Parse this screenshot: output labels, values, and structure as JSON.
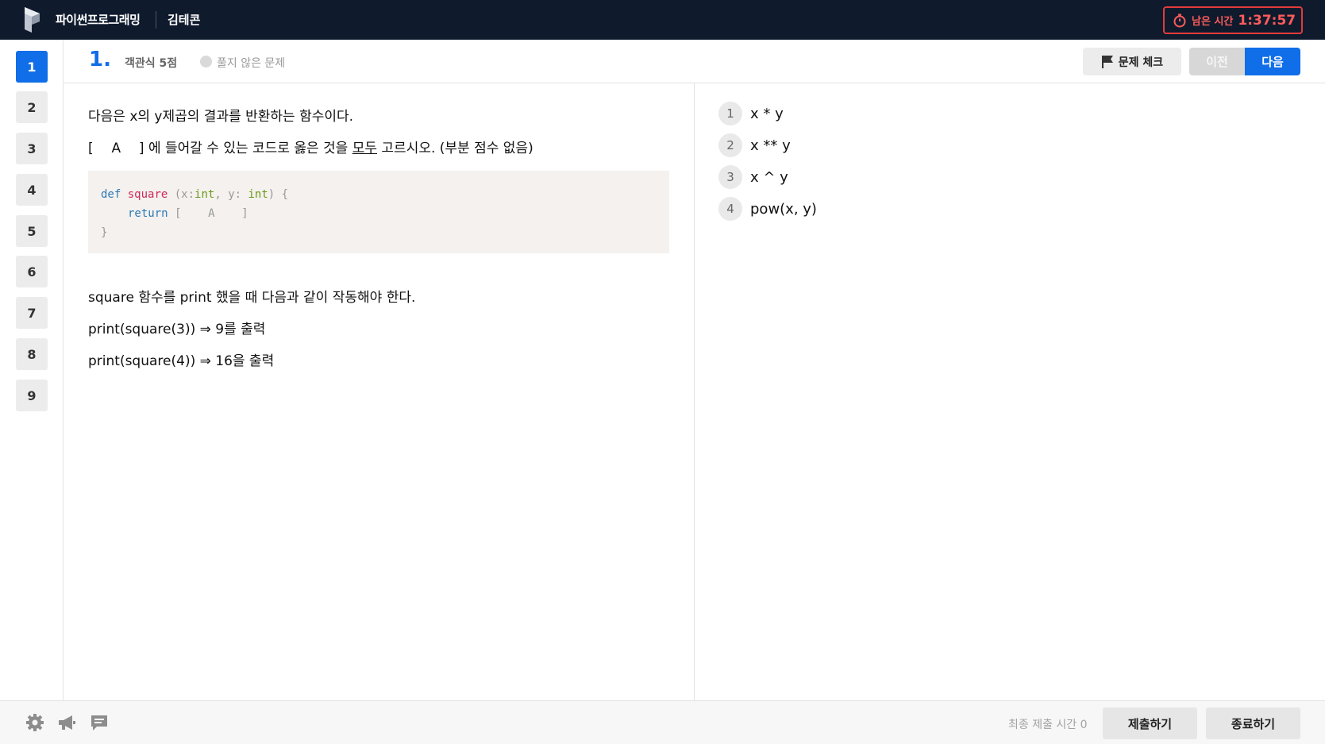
{
  "header": {
    "brand": "파이썬프로그래밍",
    "user": "김테콘",
    "timer_label": "남은 시간",
    "timer_value": "1:37:57",
    "icons": {
      "logo": "platform-logo",
      "timer": "stopwatch-icon"
    }
  },
  "nav": {
    "questions": [
      "1",
      "2",
      "3",
      "4",
      "5",
      "6",
      "7",
      "8",
      "9"
    ],
    "active": "1"
  },
  "question": {
    "number": "1.",
    "type": "객관식 5점",
    "status": "풀지 않은 문제",
    "flag_label": "문제 체크",
    "prev_label": "이전",
    "next_label": "다음",
    "line1": "다음은 x의 y제곱의 결과를 반환하는 함수이다.",
    "line2_open": "[",
    "line2_blank": "A",
    "line2_close": "] 에 들어갈 수 있는 코드로 옳은 것을",
    "line2_emph": "모두",
    "line2_tail": "고르시오. (부분 점수 없음)",
    "code": {
      "l1_def": "def",
      "l1_fn": "square",
      "l1_open": "(x:",
      "l1_t1": "int",
      "l1_mid": ", y:",
      "l1_t2": "int",
      "l1_close": ") {",
      "l2_ret": "return",
      "l2_rest": "[    A    ]",
      "l3": "}"
    },
    "desc1": "square 함수를 print 했을 때 다음과 같이 작동해야 한다.",
    "desc2": "print(square(3)) ⇒ 9를 출력",
    "desc3": "print(square(4)) ⇒ 16을 출력"
  },
  "answers": [
    {
      "num": "1",
      "text": "x * y"
    },
    {
      "num": "2",
      "text": "x ** y"
    },
    {
      "num": "3",
      "text": "x ^ y"
    },
    {
      "num": "4",
      "text": "pow(x, y)"
    }
  ],
  "footer": {
    "final_time": "최종 제출 시간 0",
    "submit_label": "제출하기",
    "end_label": "종료하기",
    "icons": [
      "gear-icon",
      "megaphone-icon",
      "chat-icon"
    ]
  },
  "colors": {
    "accent": "#0f6ee8",
    "topbar": "#0f1b2d",
    "timer": "#e23b3b"
  }
}
